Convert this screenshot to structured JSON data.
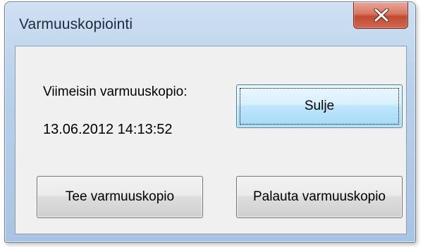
{
  "window": {
    "title": "Varmuuskopiointi",
    "close_icon": "close-icon"
  },
  "dialog": {
    "last_backup_label": "Viimeisin varmuuskopio:",
    "last_backup_value": "13.06.2012 14:13:52",
    "close_button_label": "Sulje",
    "backup_button_label": "Tee varmuuskopio",
    "restore_button_label": "Palauta varmuuskopio"
  },
  "colors": {
    "titlebar": "#b9d1ea",
    "close_button": "#c24b33",
    "client_background": "#f0f0f0",
    "default_button": "#bee6fd"
  }
}
